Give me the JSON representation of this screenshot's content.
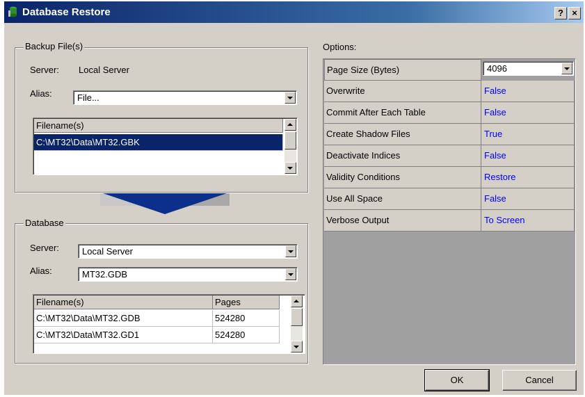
{
  "window": {
    "title": "Database Restore",
    "help_label": "?",
    "close_label": "×"
  },
  "backup": {
    "group_label": "Backup File(s)",
    "server_label": "Server:",
    "server_value": "Local Server",
    "alias_label": "Alias:",
    "alias_value": "File...",
    "files_header": "Filename(s)",
    "files": [
      "C:\\MT32\\Data\\MT32.GBK"
    ]
  },
  "database": {
    "group_label": "Database",
    "server_label": "Server:",
    "server_value": "Local Server",
    "alias_label": "Alias:",
    "alias_value": "MT32.GDB",
    "files_header": "Filename(s)",
    "pages_header": "Pages",
    "files": [
      {
        "name": "C:\\MT32\\Data\\MT32.GDB",
        "pages": "524280"
      },
      {
        "name": "C:\\MT32\\Data\\MT32.GD1",
        "pages": "524280"
      }
    ]
  },
  "options": {
    "label": "Options:",
    "page_size_label": "Page Size (Bytes)",
    "page_size_value": "4096",
    "rows": [
      {
        "name": "Overwrite",
        "value": "False"
      },
      {
        "name": "Commit After Each Table",
        "value": "False"
      },
      {
        "name": "Create Shadow Files",
        "value": "True"
      },
      {
        "name": "Deactivate Indices",
        "value": "False"
      },
      {
        "name": "Validity Conditions",
        "value": "Restore"
      },
      {
        "name": "Use All Space",
        "value": "False"
      },
      {
        "name": "Verbose Output",
        "value": "To Screen"
      }
    ]
  },
  "buttons": {
    "ok": "OK",
    "cancel": "Cancel"
  },
  "colors": {
    "title_bar": "#0a246a",
    "selection": "#0a246a",
    "option_value": "#0000ff",
    "arrow": "#0b2f8a"
  },
  "icons": {
    "app": "database-restore-icon",
    "direction": "down-arrow-icon"
  }
}
